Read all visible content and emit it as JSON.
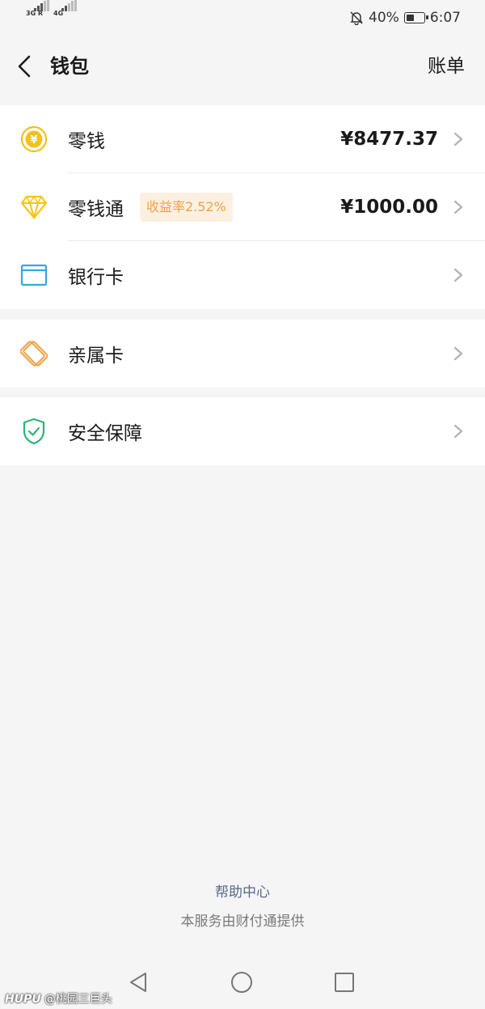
{
  "status_bar": {
    "network1": "3G R",
    "network2": "4G",
    "battery_pct": "40%",
    "battery_level": 0.4,
    "time": "6:07",
    "icons": [
      "signal-icon",
      "bell-off-icon",
      "battery-icon"
    ]
  },
  "header": {
    "title": "钱包",
    "bill_label": "账单",
    "back_icon": "back-arrow-icon"
  },
  "groups": [
    {
      "rows": [
        {
          "label": "零钱",
          "amount": "¥8477.37",
          "icon": "yuan-coin-icon",
          "color": "#f2c21b"
        },
        {
          "label": "零钱通",
          "badge": "收益率2.52%",
          "amount": "¥1000.00",
          "icon": "diamond-icon",
          "color": "#f5c518"
        },
        {
          "label": "银行卡",
          "amount": "",
          "icon": "bank-card-icon",
          "color": "#3aa5e0"
        }
      ]
    },
    {
      "rows": [
        {
          "label": "亲属卡",
          "icon": "family-card-icon",
          "color": "#f0a245"
        }
      ]
    },
    {
      "rows": [
        {
          "label": "安全保障",
          "icon": "shield-check-icon",
          "color": "#2bb673"
        }
      ]
    }
  ],
  "footer": {
    "help": "帮助中心",
    "provider": "本服务由财付通提供"
  },
  "watermark": {
    "brand": "HUPU",
    "user": "@桃园三巨头"
  },
  "navbar": {
    "icons": [
      "nav-back-icon",
      "nav-home-icon",
      "nav-recents-icon"
    ]
  }
}
